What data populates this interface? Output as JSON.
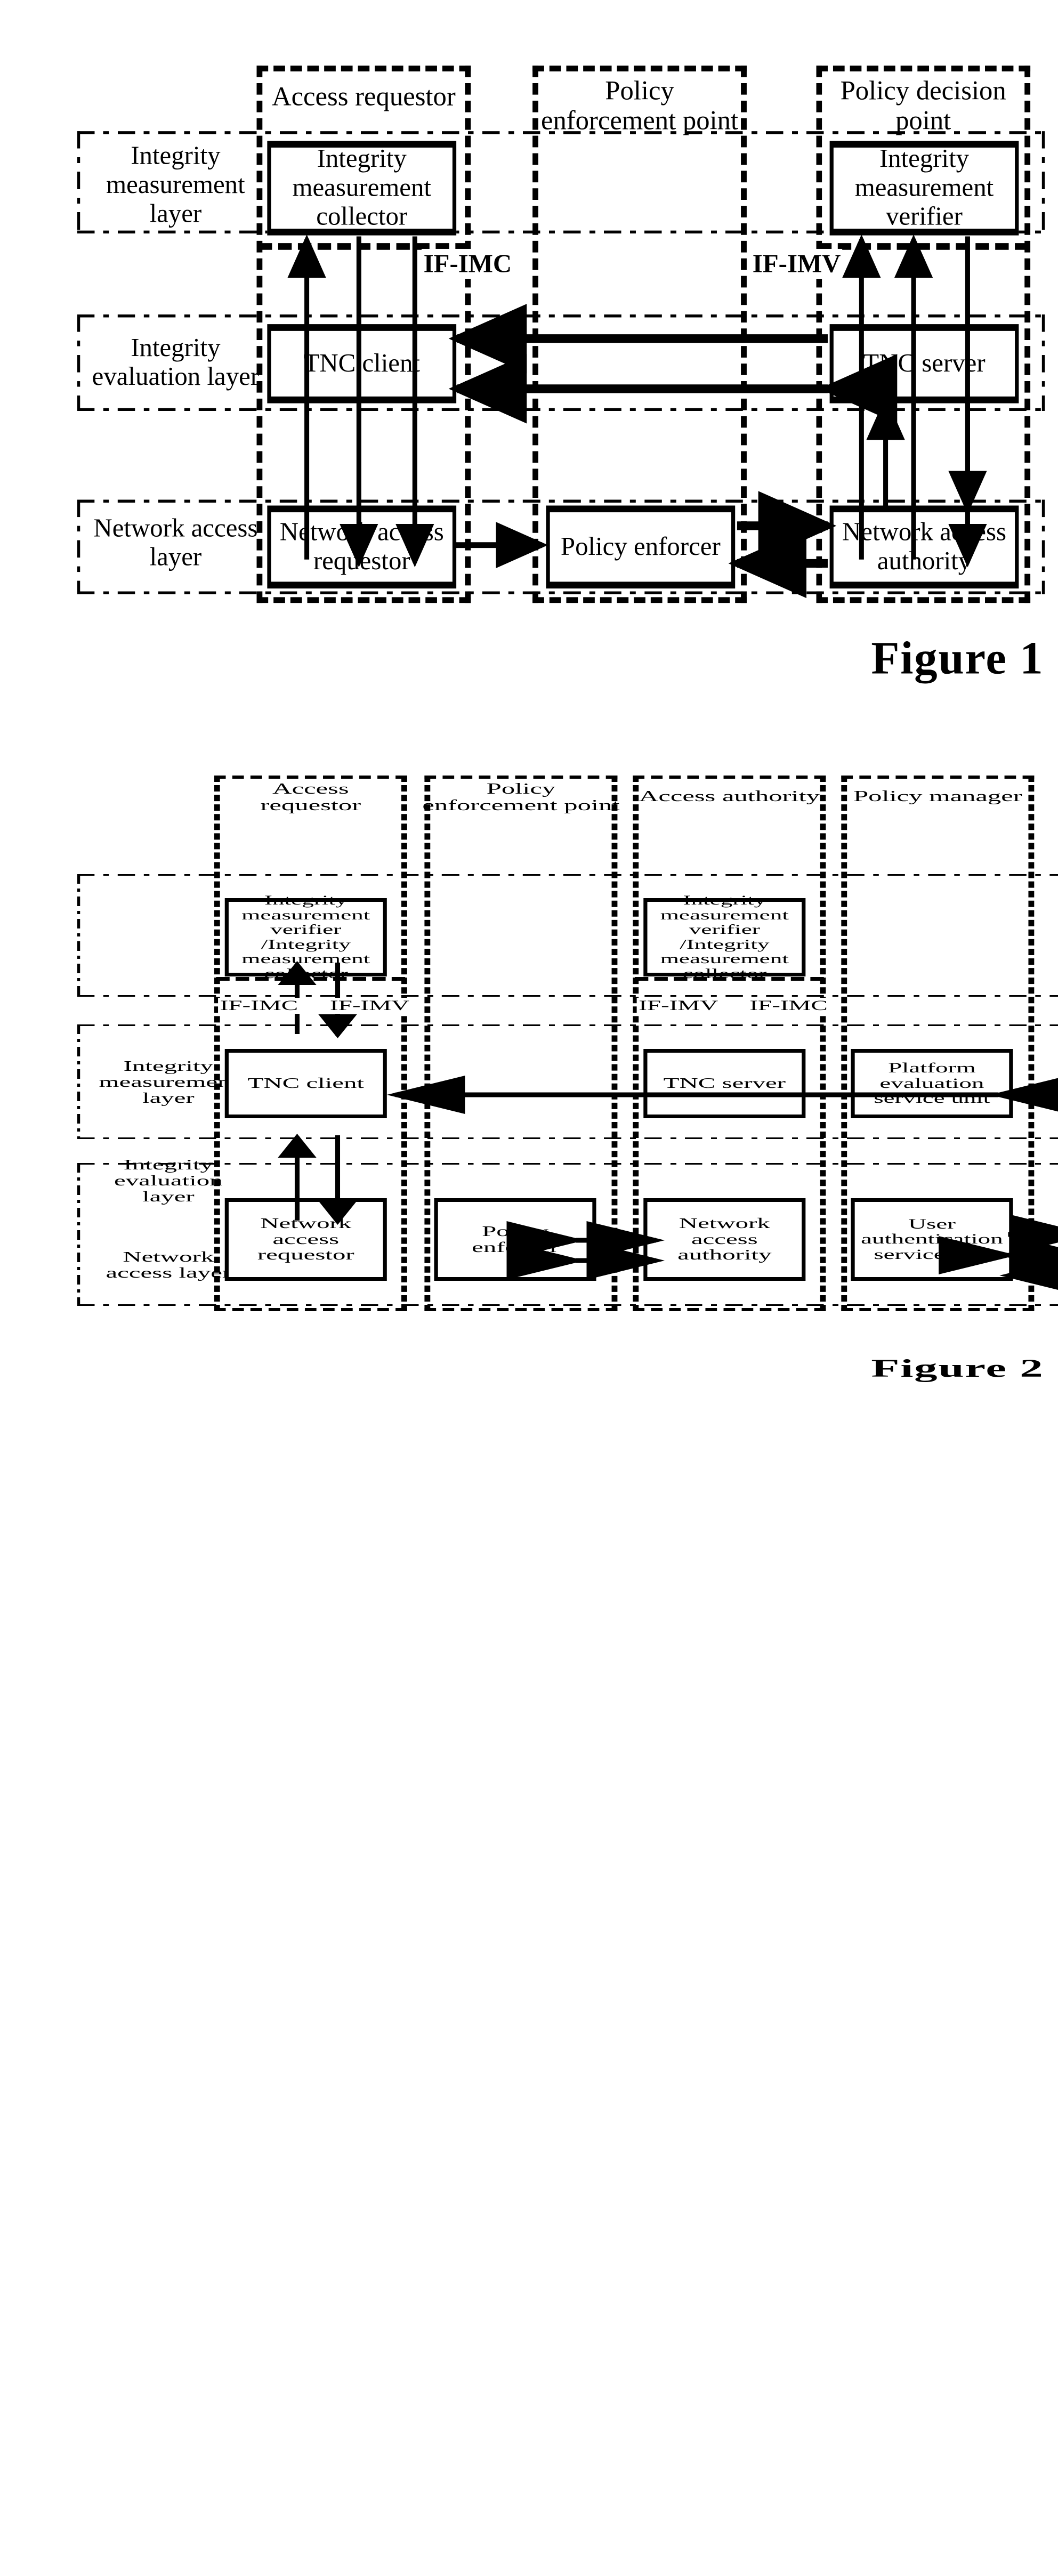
{
  "figure1": {
    "caption": "Figure 1",
    "layers": [
      {
        "id": "integrity-measurement-layer",
        "label": "Integrity\nmeasurement\nlayer"
      },
      {
        "id": "integrity-evaluation-layer",
        "label": "Integrity\nevaluation layer"
      },
      {
        "id": "network-access-layer",
        "label": "Network access\nlayer"
      }
    ],
    "columns": [
      {
        "id": "access-requestor",
        "title": "Access requestor"
      },
      {
        "id": "policy-enforcement-point",
        "title": "Policy\nenforcement point"
      },
      {
        "id": "policy-decision-point",
        "title": "Policy decision\npoint"
      }
    ],
    "boxes": [
      {
        "id": "integrity-measurement-collector",
        "label": "Integrity\nmeasurement\ncollector"
      },
      {
        "id": "integrity-measurement-verifier",
        "label": "Integrity\nmeasurement\nverifier"
      },
      {
        "id": "tnc-client",
        "label": "TNC client"
      },
      {
        "id": "tnc-server",
        "label": "TNC server"
      },
      {
        "id": "network-access-requestor",
        "label": "Network access\nrequestor"
      },
      {
        "id": "policy-enforcer",
        "label": "Policy enforcer"
      },
      {
        "id": "network-access-authority",
        "label": "Network access\nauthority"
      }
    ],
    "interfaces": [
      {
        "id": "if-imc",
        "label": "IF-IMC"
      },
      {
        "id": "if-imv",
        "label": "IF-IMV"
      }
    ]
  },
  "figure2": {
    "caption": "Figure 2",
    "layers": [
      {
        "id": "integrity-measurement-layer",
        "label": "Integrity\nmeasurement\nlayer"
      },
      {
        "id": "integrity-evaluation-layer",
        "label": "Integrity\nevaluation\nlayer"
      },
      {
        "id": "network-access-layer",
        "label": "Network\naccess layer"
      }
    ],
    "columns": [
      {
        "id": "access-requestor",
        "title": "Access\nrequestor"
      },
      {
        "id": "policy-enforcement-point",
        "title": "Policy\nenforcement point"
      },
      {
        "id": "access-authority",
        "title": "Access authority"
      },
      {
        "id": "policy-manager",
        "title": "Policy manager"
      }
    ],
    "boxes": [
      {
        "id": "ar-imv-imc",
        "label": "Integrity\nmeasurement\nverifier\n/Integrity\nmeasurement\ncollector"
      },
      {
        "id": "aa-imv-imc",
        "label": "Integrity\nmeasurement\nverifier\n/Integrity\nmeasurement\ncollector"
      },
      {
        "id": "tnc-client",
        "label": "TNC client"
      },
      {
        "id": "tnc-server",
        "label": "TNC server"
      },
      {
        "id": "platform-evaluation-service-unit",
        "label": "Platform\nevaluation\nservice unit"
      },
      {
        "id": "network-access-requestor",
        "label": "Network access\nrequestor"
      },
      {
        "id": "policy-enforcer",
        "label": "Policy enforcer"
      },
      {
        "id": "network-access-authority",
        "label": "Network access\nauthority"
      },
      {
        "id": "user-authentication-service-unit",
        "label": "User\nauthentication\nservice unit"
      }
    ],
    "interfaces": [
      {
        "id": "ar-if-imc",
        "label": "IF-IMC"
      },
      {
        "id": "ar-if-imv",
        "label": "IF-IMV"
      },
      {
        "id": "aa-if-imv",
        "label": "IF-IMV"
      },
      {
        "id": "aa-if-imc",
        "label": "IF-IMC"
      }
    ]
  }
}
